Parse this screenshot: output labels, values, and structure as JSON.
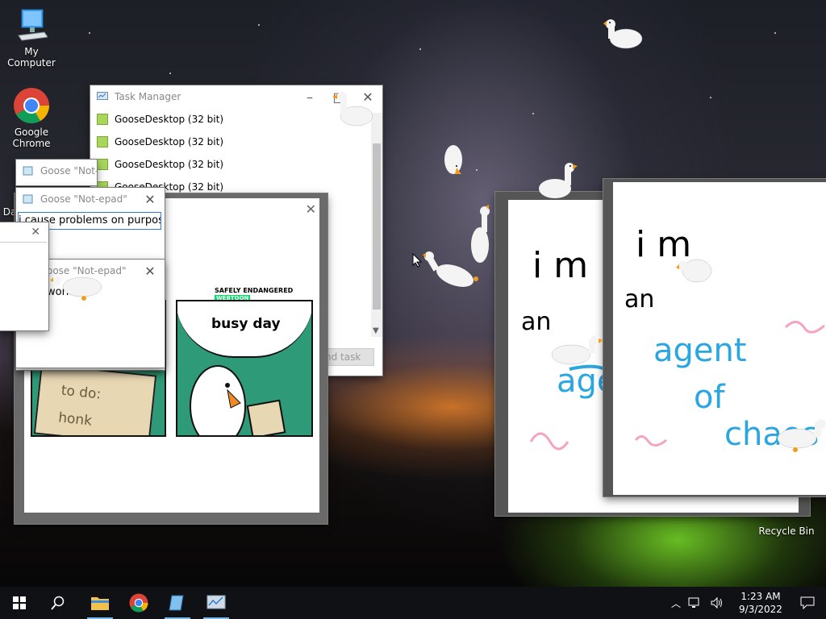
{
  "desktop": {
    "icons": [
      {
        "label": "My Computer",
        "icon": "computer-icon"
      },
      {
        "label": "Google Chrome",
        "icon": "chrome-icon"
      },
      {
        "label": "Da",
        "icon": "file-icon"
      },
      {
        "label": "Recycle Bin",
        "icon": "recycle-bin-icon"
      }
    ]
  },
  "task_manager": {
    "title": "Task Manager",
    "processes": [
      "GooseDesktop (32 bit)",
      "GooseDesktop (32 bit)",
      "GooseDesktop (32 bit)",
      "GooseDesktop (32 bit)"
    ],
    "end_task": "nd task"
  },
  "notepads": [
    {
      "title": "Goose \"Not-e"
    },
    {
      "title": "Goose \"Not-epad\"",
      "text": "i cause problems on purpose"
    },
    {
      "title": "oose \"Not-epad\"",
      "text": "work"
    }
  ],
  "meme": {
    "badge": "SAFELY ENDANGERED",
    "badge_sub": "WEBTOON",
    "panel1_text": "to do:\nhonk",
    "panel2_text": "busy day"
  },
  "drawings": [
    {
      "lines": [
        "i m",
        "an",
        "age",
        "a"
      ]
    },
    {
      "lines": [
        "i m",
        "an",
        "agent",
        "of",
        "chaos"
      ]
    }
  ],
  "taskbar": {
    "time": "1:23 AM",
    "date": "9/3/2022",
    "apps": [
      "start-icon",
      "search-icon",
      "file-explorer-icon",
      "chrome-icon",
      "notepad-icon",
      "task-manager-icon"
    ]
  },
  "colors": {
    "accent": "#76b9ed",
    "meme_green": "#2f9a78",
    "drawing_blue": "#2aa6e0",
    "drawing_pink": "#f4a3c0"
  }
}
